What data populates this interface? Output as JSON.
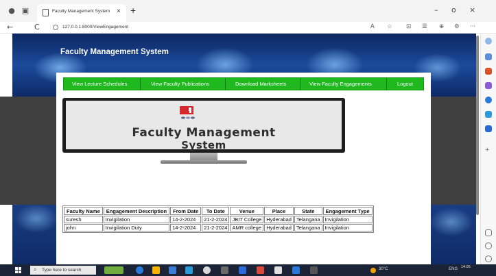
{
  "browser": {
    "tab_title": "Faculty Management System",
    "tab_close": "×",
    "new_tab": "+",
    "url": "127.0.0.1:8000/ViewEngagement",
    "back": "←",
    "refresh": "C",
    "minimize": "–",
    "restore": "o",
    "close": "×",
    "more": "···"
  },
  "site": {
    "title": "Faculty Management System"
  },
  "nav": [
    "View Lecture Schedules",
    "View Faculty Publications",
    "Download Marksheets",
    "View Faculty Engagements",
    "Logout"
  ],
  "banner": {
    "title_line1": "Faculty Management",
    "title_line2": "System"
  },
  "table": {
    "headers": [
      "Faculty Name",
      "Engagement Description",
      "From Date",
      "To Date",
      "Venue",
      "Place",
      "State",
      "Engagement Type"
    ],
    "rows": [
      [
        "suresh",
        "Invigilation",
        "14-2-2024",
        "21-2-2024",
        "JBIT College",
        "Hyderabad",
        "Telangana",
        "Invigilation"
      ],
      [
        "john",
        "Invigilation Duty",
        "14-2-2024",
        "21-2-2024",
        "AMR college",
        "Hyderabad",
        "Telangana",
        "Invigilation"
      ]
    ]
  },
  "taskbar": {
    "search_placeholder": "Type here to search",
    "temperature": "30°C",
    "lang": "ENG",
    "time": "14:05"
  },
  "colors": {
    "nav_green": "#1fb81f",
    "hero_blue": "#1c4a9c",
    "dark_band": "#3f3f3f"
  }
}
